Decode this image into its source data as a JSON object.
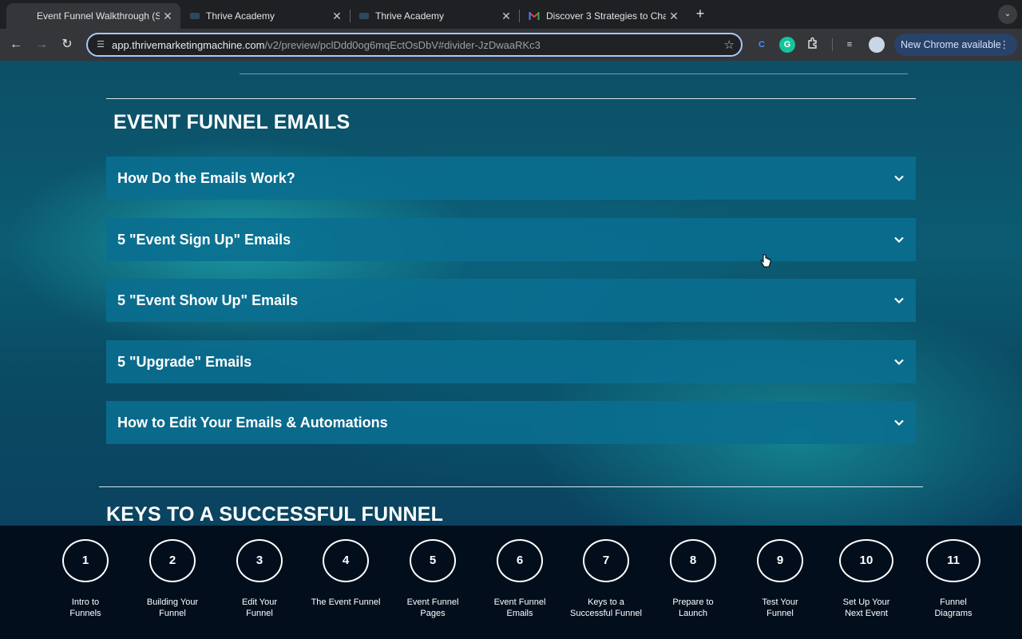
{
  "browser": {
    "tabs": [
      {
        "title": "Event Funnel Walkthrough (S",
        "active": true
      },
      {
        "title": "Thrive Academy",
        "active": false
      },
      {
        "title": "Thrive Academy",
        "active": false
      },
      {
        "title": "Discover 3 Strategies to Char",
        "active": false
      }
    ],
    "url_host": "app.thrivemarketingmachine.com",
    "url_path": "/v2/preview/pclDdd0og6mqEctOsDbV#divider-JzDwaaRKc3",
    "update_button": "New Chrome available"
  },
  "page": {
    "section_title": "EVENT FUNNEL EMAILS",
    "accordion": [
      {
        "label": "How Do the Emails Work?"
      },
      {
        "label": "5 \"Event Sign Up\" Emails"
      },
      {
        "label": "5 \"Event Show Up\" Emails"
      },
      {
        "label": "5 \"Upgrade\" Emails"
      },
      {
        "label": "How to Edit Your Emails & Automations"
      }
    ],
    "next_section_title": "KEYS TO A SUCCESSFUL FUNNEL"
  },
  "steps": [
    {
      "num": "1",
      "caption": "Intro to\nFunnels"
    },
    {
      "num": "2",
      "caption": "Building Your\nFunnel"
    },
    {
      "num": "3",
      "caption": "Edit Your\nFunnel"
    },
    {
      "num": "4",
      "caption": "The Event Funnel"
    },
    {
      "num": "5",
      "caption": "Event Funnel\nPages"
    },
    {
      "num": "6",
      "caption": "Event Funnel\nEmails"
    },
    {
      "num": "7",
      "caption": "Keys to a\nSuccessful Funnel"
    },
    {
      "num": "8",
      "caption": "Prepare to\nLaunch"
    },
    {
      "num": "9",
      "caption": "Test Your\nFunnel"
    },
    {
      "num": "10",
      "caption": "Set Up Your\nNext Event"
    },
    {
      "num": "11",
      "caption": "Funnel\nDiagrams"
    }
  ]
}
